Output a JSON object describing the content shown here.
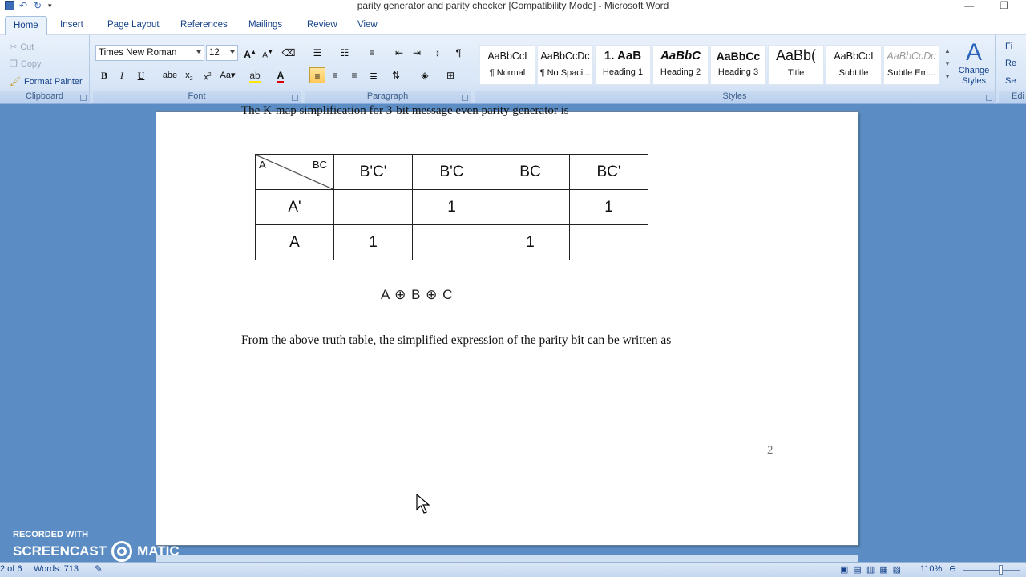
{
  "window": {
    "title": "parity generator and parity checker [Compatibility Mode] - Microsoft Word",
    "minimize_icon": "minimize-icon",
    "restore_icon": "restore-icon"
  },
  "tabs": [
    "Home",
    "Insert",
    "Page Layout",
    "References",
    "Mailings",
    "Review",
    "View"
  ],
  "clipboard": {
    "cut": "Cut",
    "copy": "Copy",
    "format_painter": "Format Painter",
    "label": "Clipboard"
  },
  "font": {
    "name": "Times New Roman",
    "size": "12",
    "label": "Font"
  },
  "paragraph": {
    "label": "Paragraph"
  },
  "styles": {
    "label": "Styles",
    "items": [
      {
        "preview": "AaBbCcI",
        "name": "¶ Normal"
      },
      {
        "preview": "AaBbCcDc",
        "name": "¶ No Spaci..."
      },
      {
        "preview": "1. AaB",
        "name": "Heading 1"
      },
      {
        "preview": "AaBbC",
        "name": "Heading 2"
      },
      {
        "preview": "AaBbCc",
        "name": "Heading 3"
      },
      {
        "preview": "AaBb(",
        "name": "Title"
      },
      {
        "preview": "AaBbCcI",
        "name": "Subtitle"
      },
      {
        "preview": "AaBbCcDc",
        "name": "Subtle Em..."
      }
    ],
    "change_styles": "Change Styles"
  },
  "editing": {
    "label": "Edi",
    "find": "Fi",
    "replace": "Re",
    "select": "Se"
  },
  "document": {
    "cut_line": "The K-map simplification for 3-bit message even parity generator is",
    "kmap": {
      "corner_row": "A",
      "corner_col": "BC",
      "col_headers": [
        "B'C'",
        "B'C",
        "BC",
        "BC'"
      ],
      "rows": [
        {
          "label": "A'",
          "cells": [
            "",
            "1",
            "",
            "1"
          ]
        },
        {
          "label": "A",
          "cells": [
            "1",
            "",
            "1",
            ""
          ]
        }
      ]
    },
    "expression": "A ⊕ B ⊕ C",
    "paragraph": "From the above truth table, the simplified expression of the parity bit can be written as",
    "page_number": "2"
  },
  "status": {
    "page": "2 of 6",
    "words": "Words: 713",
    "zoom": "110%"
  },
  "watermark": {
    "line1": "RECORDED WITH",
    "line2a": "SCREENCAST",
    "line2b": "MATIC"
  }
}
